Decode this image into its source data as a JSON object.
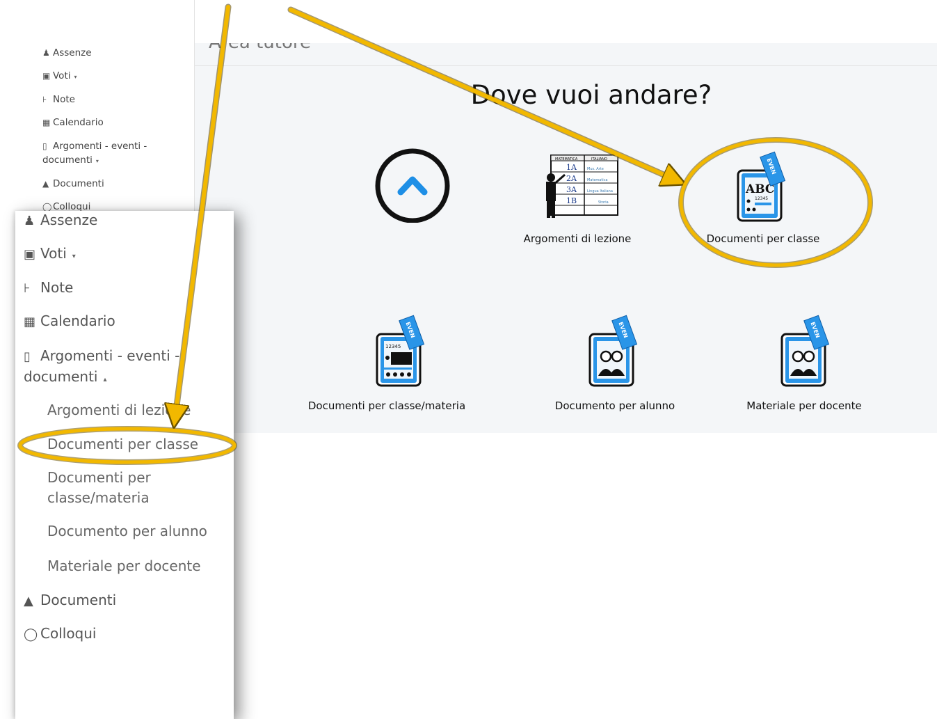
{
  "sidebar_small": {
    "items": [
      {
        "icon": "user-icon",
        "label": "Assenze"
      },
      {
        "icon": "bank-icon",
        "label": "Voti",
        "caret": "▾"
      },
      {
        "icon": "pin-icon",
        "label": "Note"
      },
      {
        "icon": "calendar-icon",
        "label": "Calendario"
      },
      {
        "icon": "folder-open-icon",
        "label": "Argomenti - eventi -",
        "label2": "documenti",
        "caret": "▾"
      },
      {
        "icon": "graduation-cap-icon",
        "label": "Documenti"
      },
      {
        "icon": "chat-icon",
        "label": "Colloqui"
      }
    ]
  },
  "header": {
    "title": "Area tutore"
  },
  "main": {
    "headline": "Dove vuoi andare?",
    "tiles": [
      {
        "label": "",
        "icon": "back-to-top-icon"
      },
      {
        "label": "Argomenti di lezione",
        "icon": "teacher-board-icon"
      },
      {
        "label": "Documenti per classe",
        "icon": "abc-document-icon"
      },
      {
        "label": "Documenti per classe/materia",
        "icon": "class-subject-document-icon"
      },
      {
        "label": "Documento per alunno",
        "icon": "student-document-icon"
      },
      {
        "label": "Materiale per docente",
        "icon": "teacher-material-icon"
      }
    ],
    "ticket_text": "EVEN",
    "board": {
      "headers": [
        "MATEMATICA",
        "ITALIANO"
      ],
      "rows": [
        {
          "cls": "1A",
          "subj": "Mus. Arte"
        },
        {
          "cls": "2A",
          "subj": "Matematica"
        },
        {
          "cls": "3A",
          "subj": "Lingua Italiana"
        },
        {
          "cls": "1B",
          "subj": "Storia"
        }
      ]
    },
    "abc_text": "ABC",
    "numbers_text": "12345"
  },
  "sidebar_zoom": {
    "items": [
      {
        "icon": "user-icon",
        "label": "Assenze"
      },
      {
        "icon": "bank-icon",
        "label": "Voti",
        "caret": "▾"
      },
      {
        "icon": "pin-icon",
        "label": "Note"
      },
      {
        "icon": "calendar-icon",
        "label": "Calendario"
      },
      {
        "icon": "folder-open-icon",
        "label": "Argomenti - eventi -",
        "label2": "documenti",
        "caret": "▴"
      }
    ],
    "subitems": [
      {
        "label": "Argomenti di lezione"
      },
      {
        "label": "Documenti per classe"
      },
      {
        "label": "Documenti per",
        "label2": "classe/materia"
      },
      {
        "label": "Documento per alunno"
      },
      {
        "label": "Materiale per docente"
      }
    ],
    "bottom_items": [
      {
        "icon": "graduation-cap-icon",
        "label": "Documenti"
      },
      {
        "icon": "chat-icon",
        "label": "Colloqui"
      }
    ]
  },
  "colors": {
    "highlight": "#f2b800",
    "icon_blue": "#1e8fe6",
    "background": "#f4f6f8"
  }
}
